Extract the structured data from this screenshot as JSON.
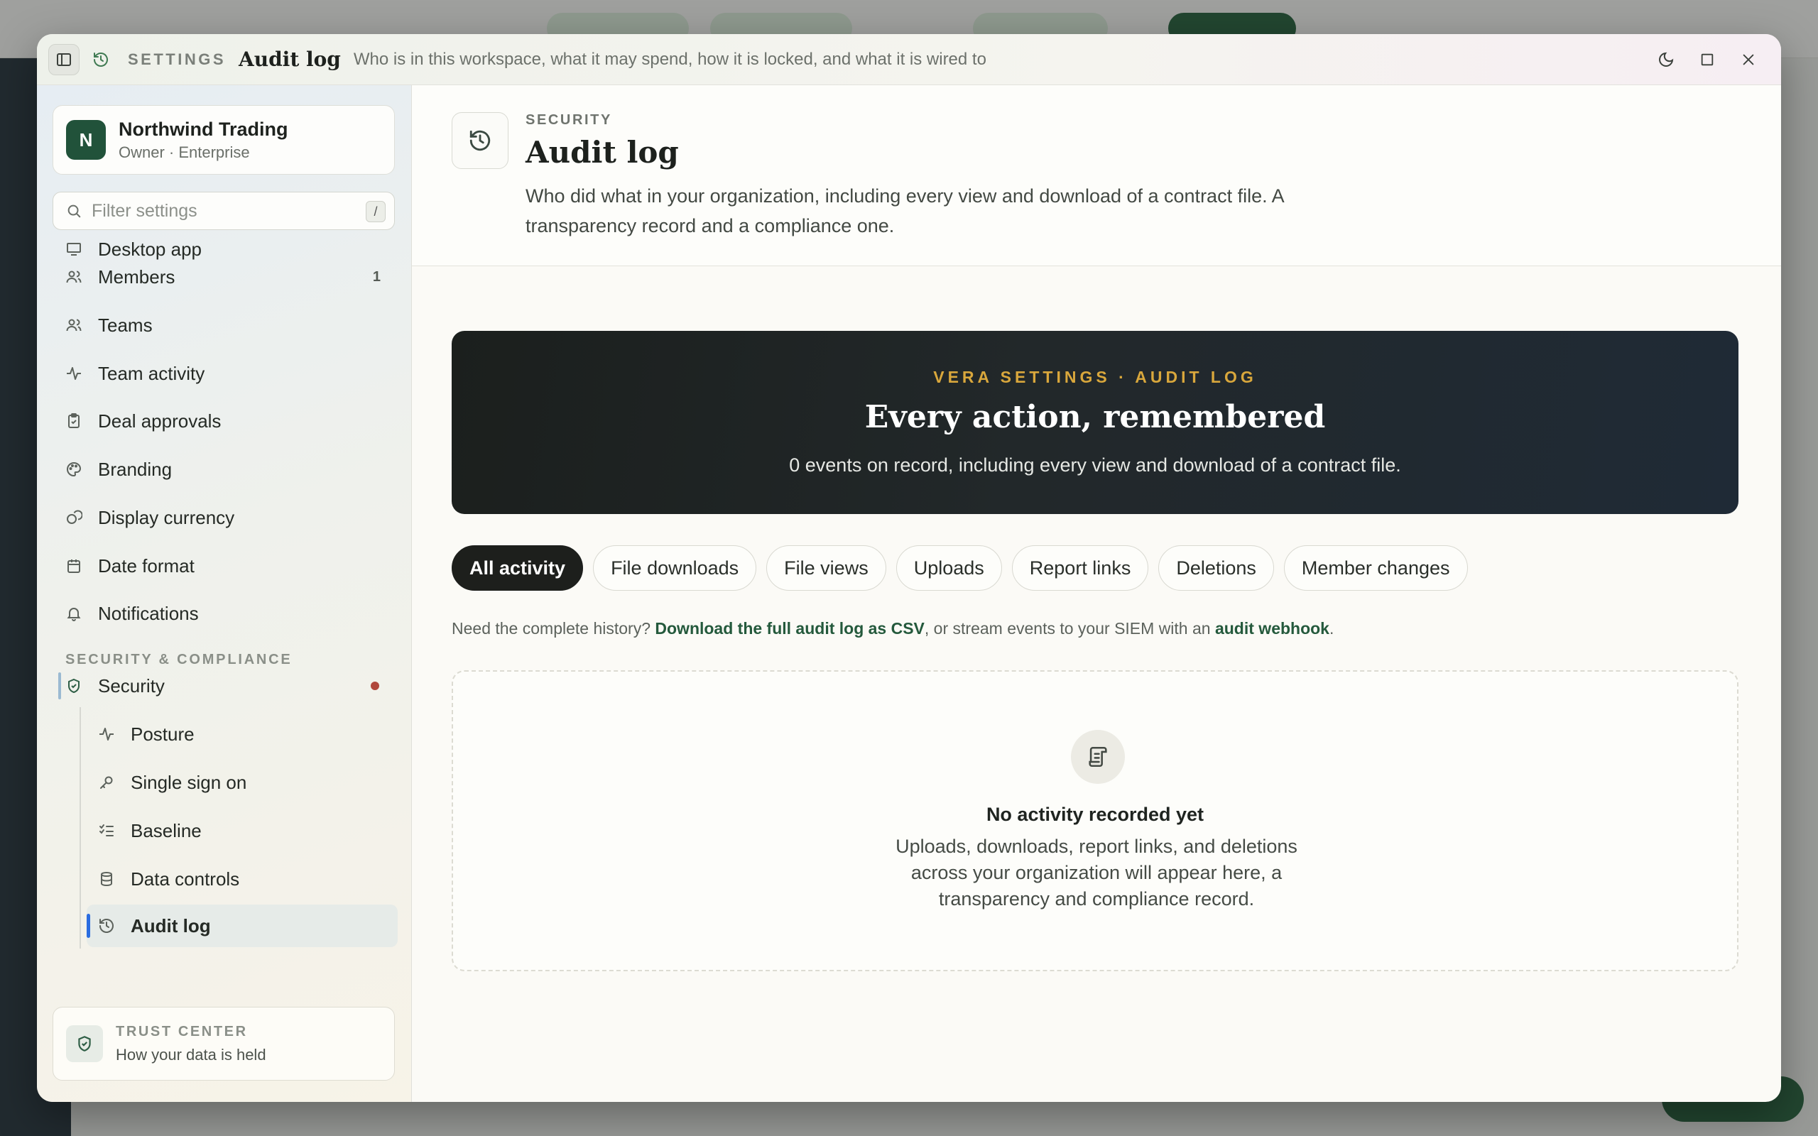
{
  "titlebar": {
    "kicker": "SETTINGS",
    "title": "Audit log",
    "subtitle": "Who is in this workspace, what it may spend, how it is locked, and what it is wired to"
  },
  "org": {
    "initial": "N",
    "name": "Northwind Trading",
    "role": "Owner · Enterprise"
  },
  "filter": {
    "placeholder": "Filter settings",
    "shortcut": "/"
  },
  "nav": {
    "items": [
      {
        "label": "Desktop app",
        "icon": "monitor-icon"
      },
      {
        "label": "Members",
        "icon": "users-icon",
        "badge": "1"
      },
      {
        "label": "Teams",
        "icon": "users-icon"
      },
      {
        "label": "Team activity",
        "icon": "activity-icon"
      },
      {
        "label": "Deal approvals",
        "icon": "clipboard-check-icon"
      },
      {
        "label": "Branding",
        "icon": "palette-icon"
      },
      {
        "label": "Display currency",
        "icon": "coins-icon"
      },
      {
        "label": "Date format",
        "icon": "calendar-icon"
      },
      {
        "label": "Notifications",
        "icon": "bell-icon"
      }
    ],
    "section_head": "SECURITY & COMPLIANCE",
    "security": {
      "label": "Security",
      "icon": "shield-check-icon"
    },
    "sub_items": [
      {
        "label": "Posture",
        "icon": "activity-icon"
      },
      {
        "label": "Single sign on",
        "icon": "key-icon"
      },
      {
        "label": "Baseline",
        "icon": "list-checks-icon"
      },
      {
        "label": "Data controls",
        "icon": "database-icon"
      },
      {
        "label": "Audit log",
        "icon": "history-icon",
        "active": true
      }
    ]
  },
  "trust": {
    "kicker": "TRUST CENTER",
    "text": "How your data is held"
  },
  "header": {
    "kicker": "SECURITY",
    "title": "Audit log",
    "description": "Who did what in your organization, including every view and download of a contract file. A transparency record and a compliance one."
  },
  "hero": {
    "kicker": "VERA SETTINGS · AUDIT LOG",
    "title": "Every action, remembered",
    "subtitle": "0 events on record, including every view and download of a contract file."
  },
  "filters": [
    {
      "label": "All activity",
      "active": true
    },
    {
      "label": "File downloads"
    },
    {
      "label": "File views"
    },
    {
      "label": "Uploads"
    },
    {
      "label": "Report links"
    },
    {
      "label": "Deletions"
    },
    {
      "label": "Member changes"
    }
  ],
  "note": {
    "prefix": "Need the complete history? ",
    "csv_link": "Download the full audit log as CSV",
    "middle": ", or stream events to your SIEM with an ",
    "webhook_link": "audit webhook",
    "suffix": "."
  },
  "empty": {
    "title": "No activity recorded yet",
    "description": "Uploads, downloads, report links, and deletions across your organization will appear here, a transparency and compliance record."
  },
  "colors": {
    "accent_green": "#21523a",
    "hero_kicker": "#d9a73c",
    "active_bar": "#2b6de0",
    "alert_dot": "#b0473b"
  }
}
